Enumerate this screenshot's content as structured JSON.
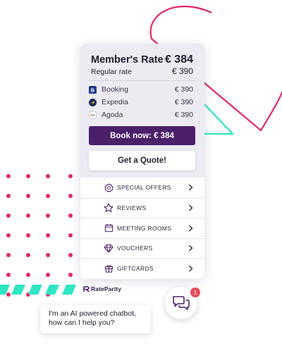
{
  "widget": {
    "member_rate_label": "Member's Rate",
    "member_rate_price": "€ 384",
    "regular_rate_label": "Regular rate",
    "regular_rate_price": "€ 390",
    "otas": [
      {
        "name": "Booking",
        "price": "€ 390",
        "icon": "booking-logo-icon"
      },
      {
        "name": "Expedia",
        "price": "€ 390",
        "icon": "expedia-logo-icon"
      },
      {
        "name": "Agoda",
        "price": "€ 390",
        "icon": "agoda-logo-icon"
      }
    ],
    "book_now_label": "Book now: € 384",
    "get_quote_label": "Get a Quote!"
  },
  "menu": [
    {
      "label": "SPECIAL OFFERS",
      "icon": "badge-icon"
    },
    {
      "label": "REVIEWS",
      "icon": "star-icon"
    },
    {
      "label": "MEETING ROOMS",
      "icon": "calendar-icon"
    },
    {
      "label": "VOUCHERS",
      "icon": "diamond-icon"
    },
    {
      "label": "GIFTCARDS",
      "icon": "gift-icon"
    }
  ],
  "brand": {
    "name": "RateParity"
  },
  "chat": {
    "badge_count": "1",
    "message_line1": "I'm an AI powered chatbot,",
    "message_line2": "how can I help you?",
    "icon": "chat-bubbles-icon"
  },
  "colors": {
    "primary": "#4c1f6b",
    "panel_bg": "#ecebf2",
    "accent_pink": "#e0276f",
    "accent_teal": "#2ee6c2",
    "badge_red": "#e34c59"
  }
}
